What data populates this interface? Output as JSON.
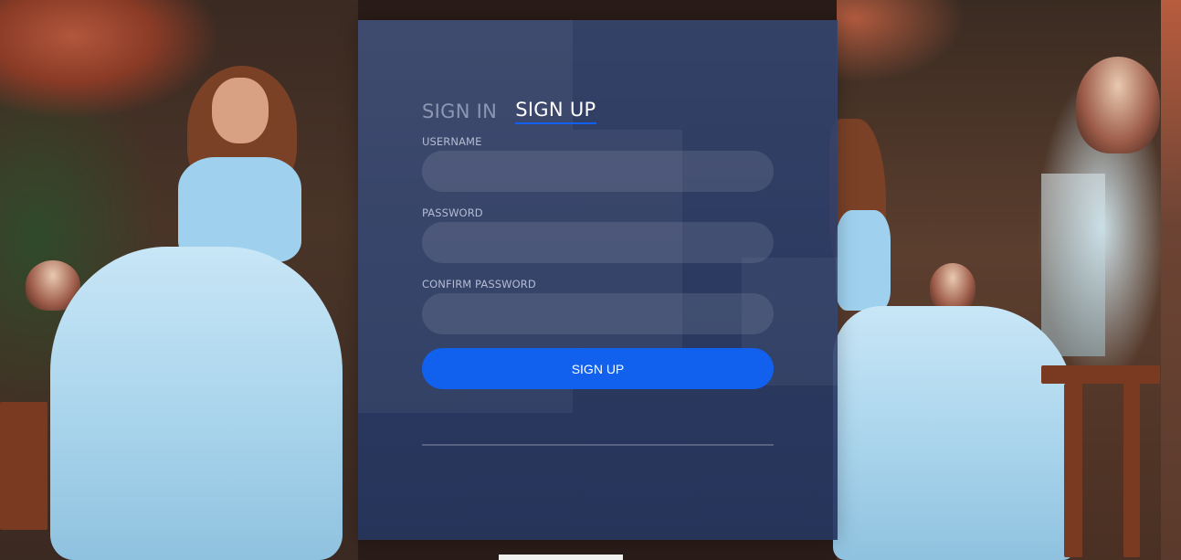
{
  "tabs": [
    {
      "label": "SIGN IN",
      "active": false
    },
    {
      "label": "SIGN UP",
      "active": true
    }
  ],
  "fields": {
    "username": {
      "label": "USERNAME",
      "value": "",
      "placeholder": ""
    },
    "password": {
      "label": "PASSWORD",
      "value": "",
      "placeholder": ""
    },
    "confirm_password": {
      "label": "CONFIRM PASSWORD",
      "value": "",
      "placeholder": ""
    }
  },
  "submit": {
    "label": "SIGN UP"
  },
  "colors": {
    "accent": "#1161ee",
    "card_background": "#283965",
    "inactive_tab": "#8d97b4",
    "field_label": "#b4bcd2"
  }
}
